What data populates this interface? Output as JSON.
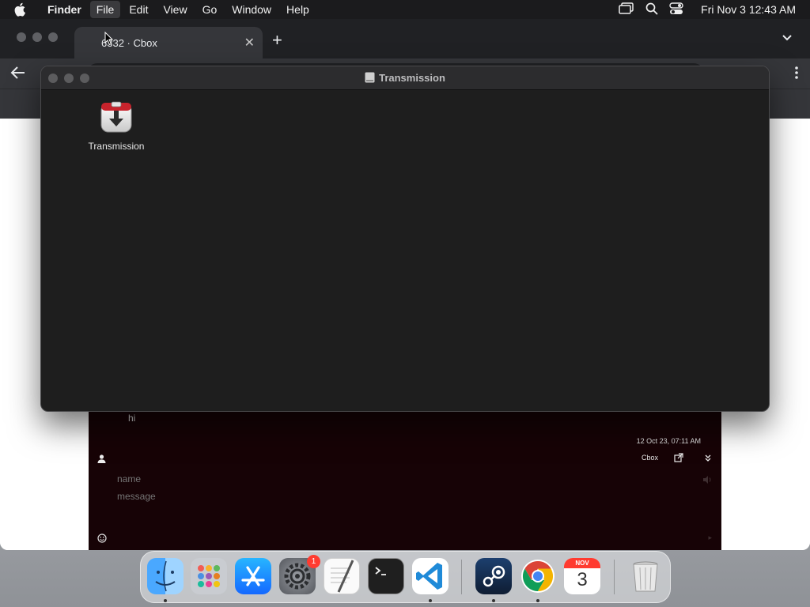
{
  "menubar": {
    "app_name": "Finder",
    "items": [
      "File",
      "Edit",
      "View",
      "Go",
      "Window",
      "Help"
    ],
    "clock": "Fri Nov 3  12:43 AM"
  },
  "browser": {
    "tab_title": "6332 · Cbox",
    "close_glyph": "✕",
    "new_tab_glyph": "+"
  },
  "cbox": {
    "message_text": "hi",
    "timestamp": "12 Oct 23, 07:11 AM",
    "cbox_link": "Cbox",
    "name_placeholder": "name",
    "message_placeholder": "message"
  },
  "finder": {
    "window_title": "Transmission",
    "items": [
      {
        "label": "Transmission",
        "icon": "transmission-app-icon"
      }
    ]
  },
  "dock": {
    "apps": [
      "Finder",
      "Launchpad",
      "App Store",
      "System Settings",
      "TextEdit",
      "Terminal",
      "Visual Studio Code",
      "Steam",
      "Google Chrome",
      "Calendar",
      "Trash"
    ],
    "settings_badge": "1",
    "calendar_month": "NOV",
    "calendar_day": "3"
  },
  "colors": {
    "menubar_bg": "#1b1b1d",
    "finder_bg": "#1e1e1e",
    "cbox_bg": "#170306",
    "badge_red": "#ff3b30"
  }
}
